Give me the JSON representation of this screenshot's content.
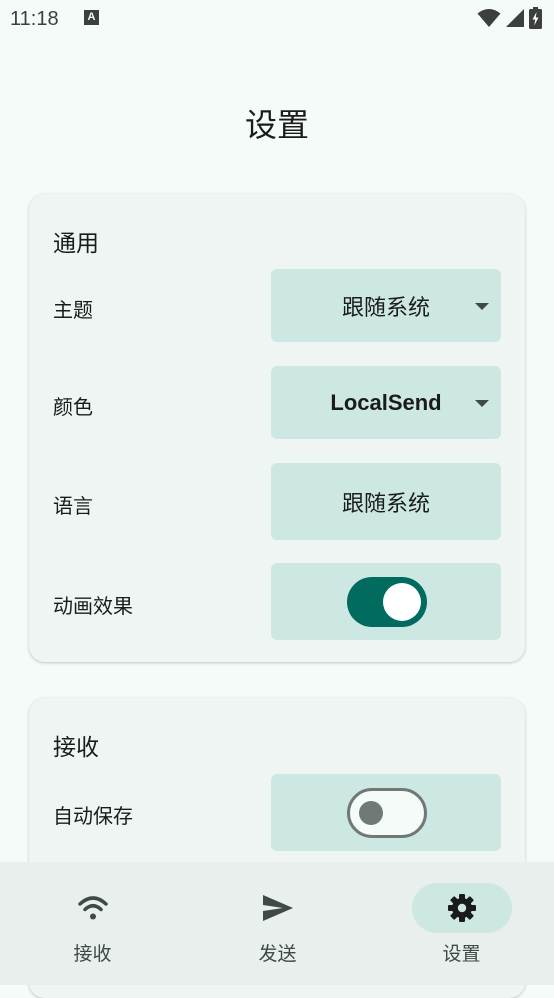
{
  "status_bar": {
    "time": "11:18",
    "notification_icon": "a-icon",
    "notification_letter": "A",
    "icons": [
      "wifi-icon",
      "signal-icon",
      "battery-icon"
    ]
  },
  "page": {
    "title": "设置"
  },
  "general": {
    "title": "通用",
    "theme": {
      "label": "主题",
      "value": "跟随系统"
    },
    "color": {
      "label": "颜色",
      "value": "LocalSend"
    },
    "language": {
      "label": "语言",
      "value": "跟随系统"
    },
    "animations": {
      "label": "动画效果",
      "enabled": true
    }
  },
  "receive": {
    "title": "接收",
    "auto_save": {
      "label": "自动保存",
      "enabled": false
    }
  },
  "nav": {
    "items": [
      {
        "label": "接收",
        "icon": "wifi-icon",
        "active": false
      },
      {
        "label": "发送",
        "icon": "send-icon",
        "active": false
      },
      {
        "label": "设置",
        "icon": "gear-icon",
        "active": true
      }
    ]
  },
  "colors": {
    "accent": "#006b5e",
    "control_bg": "#cde8e2",
    "card_bg": "#eff5f2",
    "page_bg": "#f5fbf8"
  }
}
